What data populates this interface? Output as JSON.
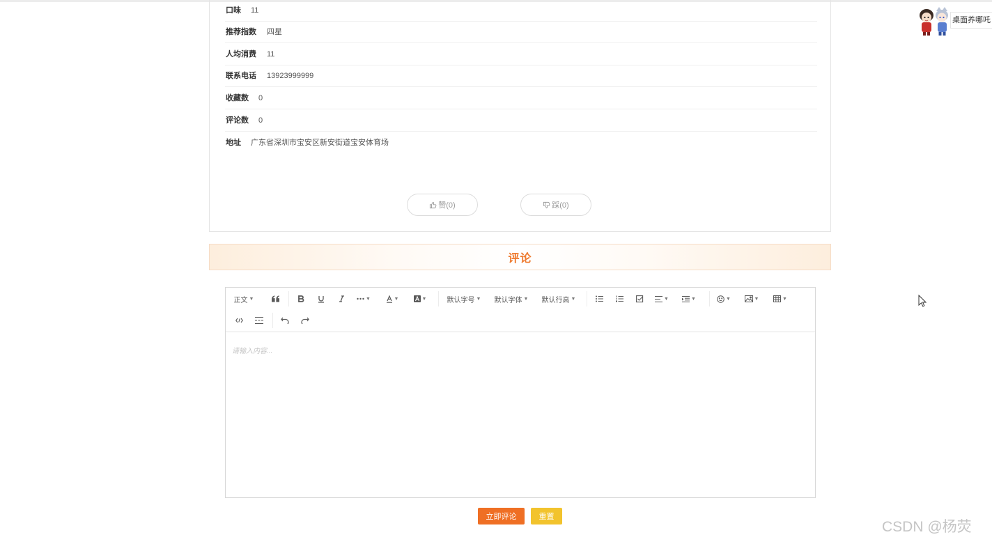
{
  "details": {
    "rows": [
      {
        "label": "口味",
        "value": "11"
      },
      {
        "label": "推荐指数",
        "value": "四星"
      },
      {
        "label": "人均消费",
        "value": "11"
      },
      {
        "label": "联系电话",
        "value": "13923999999"
      },
      {
        "label": "收藏数",
        "value": "0"
      },
      {
        "label": "评论数",
        "value": "0"
      },
      {
        "label": "地址",
        "value": "广东省深圳市宝安区新安街道宝安体育场"
      }
    ],
    "like_label": "赞(0)",
    "dislike_label": "踩(0)"
  },
  "comment": {
    "title": "评论",
    "toolbar": {
      "paragraph": "正文",
      "font_size": "默认字号",
      "font_family": "默认字体",
      "line_height": "默认行高"
    },
    "placeholder": "请输入内容...",
    "submit_label": "立即评论",
    "reset_label": "重置"
  },
  "widget": {
    "label": "桌面养哪吒"
  },
  "watermark": "CSDN @杨荧"
}
